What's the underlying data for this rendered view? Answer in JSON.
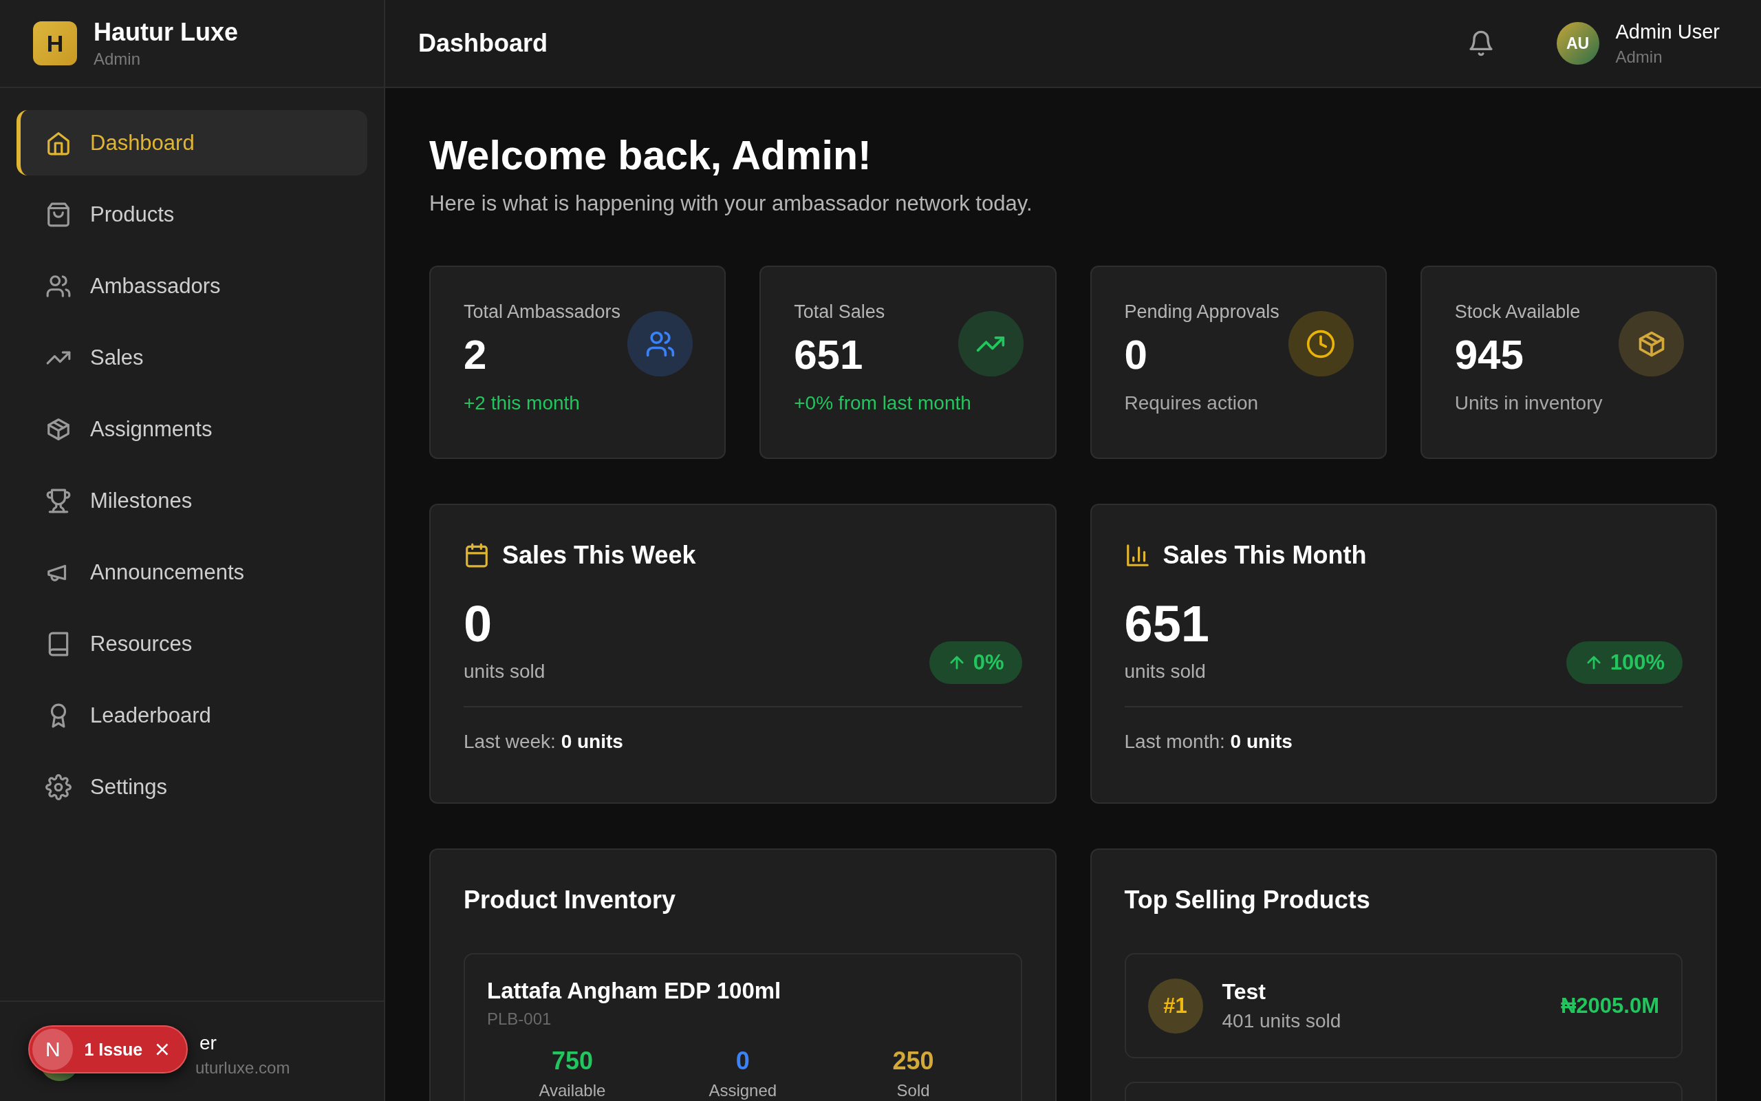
{
  "brand": {
    "logo": "H",
    "name": "Hautur Luxe",
    "role": "Admin"
  },
  "nav": [
    {
      "label": "Dashboard",
      "selected": true
    },
    {
      "label": "Products",
      "selected": false
    },
    {
      "label": "Ambassadors",
      "selected": false
    },
    {
      "label": "Sales",
      "selected": false
    },
    {
      "label": "Assignments",
      "selected": false
    },
    {
      "label": "Milestones",
      "selected": false
    },
    {
      "label": "Announcements",
      "selected": false
    },
    {
      "label": "Resources",
      "selected": false
    },
    {
      "label": "Leaderboard",
      "selected": false
    },
    {
      "label": "Settings",
      "selected": false
    }
  ],
  "sidebar_user": {
    "name": "er",
    "email": "uturluxe.com"
  },
  "issue_badge": {
    "logo": "N",
    "label": "1 Issue"
  },
  "header": {
    "title": "Dashboard",
    "user": {
      "initials": "AU",
      "name": "Admin User",
      "role": "Admin"
    }
  },
  "welcome": {
    "title": "Welcome back, Admin!",
    "subtitle": "Here is what is happening with your ambassador network today."
  },
  "stats": [
    {
      "label": "Total Ambassadors",
      "value": "2",
      "note": "+2 this month",
      "positive": true,
      "color": "#3b82f6"
    },
    {
      "label": "Total Sales",
      "value": "651",
      "note": "+0% from last month",
      "positive": true,
      "color": "#22c55e"
    },
    {
      "label": "Pending Approvals",
      "value": "0",
      "note": "Requires action",
      "positive": false,
      "color": "#eab308"
    },
    {
      "label": "Stock Available",
      "value": "945",
      "note": "Units in inventory",
      "positive": false,
      "color": "#d4a93a"
    }
  ],
  "period_cards": [
    {
      "title": "Sales This Week",
      "value": "0",
      "unit": "units sold",
      "change": "0%",
      "comparison": "Last week: **0 units**"
    },
    {
      "title": "Sales This Month",
      "value": "651",
      "unit": "units sold",
      "change": "100%",
      "comparison": "Last month: **0 units**"
    }
  ],
  "inventory": {
    "title": "Product Inventory",
    "products": [
      {
        "name": "Lattafa Angham EDP 100ml",
        "sku": "PLB-001",
        "stats": [
          {
            "value": "750",
            "label": "Available",
            "color": "#22c55e"
          },
          {
            "value": "0",
            "label": "Assigned",
            "color": "#3b82f6"
          },
          {
            "value": "250",
            "label": "Sold",
            "color": "#d4a93a"
          }
        ]
      }
    ]
  },
  "top_selling": {
    "title": "Top Selling Products",
    "items": [
      {
        "rank": "#1",
        "name": "Test",
        "units": "401 units sold",
        "revenue": "₦2005.0M"
      }
    ]
  }
}
